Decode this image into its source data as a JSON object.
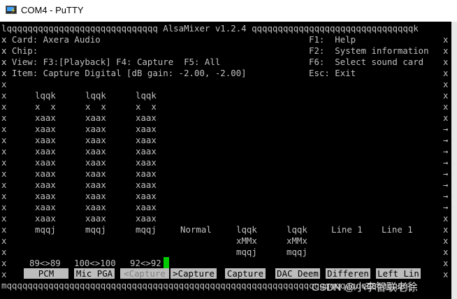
{
  "window": {
    "title": "COM4 - PuTTY"
  },
  "screen": {
    "header_line": "lqqqqqqqqqqqqqqqqqqqqqqqqqqqqq AlsaMixer v1.2.4 qqqqqqqqqqqqqqqqqqqqqqqqqqqqqqqk",
    "card_label": "x Card: Axera Audio",
    "chip_label": "x Chip:",
    "view_label": "x View: F3:[Playback] F4: Capture  F5: All",
    "item_label": "x Item: Capture Digital [dB gain: -2.00, -2.00]",
    "help_keys": [
      "F1:  Help",
      "F2:  System information",
      "F6:  Select sound card",
      "Esc: Exit"
    ],
    "bar_top": "lqqk",
    "bar_row_first": "x  x",
    "bar_row": "xaax",
    "bar_bottom": "mqqj",
    "bar_rows_count": 11,
    "normal_label": "Normal",
    "line_label_1": "Line 1",
    "line_label_2": "Line 1",
    "dac_top": "lqqk",
    "dac_mid": "xMMx",
    "dac_bottom": "mqqj",
    "values": [
      "89<>89",
      "100<>100",
      "92<>92"
    ],
    "controls": [
      "PCM",
      "Mic PGA",
      "<Capture",
      ">Capture",
      "Capture",
      "DAC Deem",
      "Differen",
      "Left Lin"
    ],
    "footer_line": "mqqqqqqqqqqqqqqqqqqqqqqqqqqqqqqqqqqqqqqqqqqqqqqqqqqqqqqqqqqqqqqqqqqqqqqqqqqqqqj",
    "watermark": "CSDN @小李智联老徐"
  }
}
